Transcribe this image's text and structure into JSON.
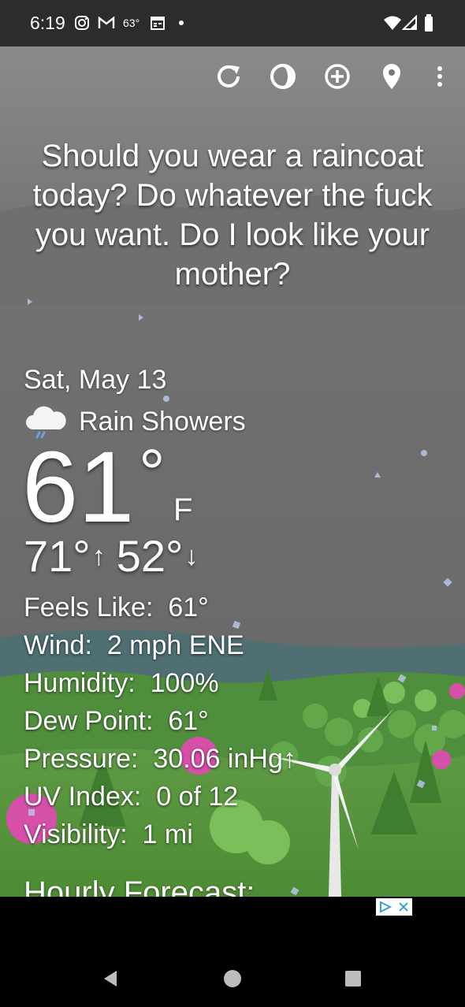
{
  "status_bar": {
    "time": "6:19",
    "temp": "63°",
    "icons": [
      "instagram-icon",
      "gmail-icon",
      "calendar-icon",
      "dot-icon",
      "wifi-icon",
      "signal-icon",
      "battery-icon"
    ]
  },
  "toolbar": {
    "icons": [
      "refresh-icon",
      "theme-icon",
      "add-location-icon",
      "location-pin-icon",
      "more-vert-icon"
    ]
  },
  "quote": "Should you wear a raincoat today? Do whatever the fuck you want. Do I look like your mother?",
  "weather": {
    "date": "Sat, May 13",
    "condition": "Rain Showers",
    "condition_icon": "rain-cloud-icon",
    "temperature": "61",
    "degree_symbol": "°",
    "unit": "F",
    "high": "71°",
    "high_arrow": "↑",
    "low": "52°",
    "low_arrow": "↓"
  },
  "details": [
    {
      "label": "Feels Like:",
      "value": "61°"
    },
    {
      "label": "Wind:",
      "value": "2 mph ENE"
    },
    {
      "label": "Humidity:",
      "value": "100%"
    },
    {
      "label": "Dew Point:",
      "value": "61°"
    },
    {
      "label": "Pressure:",
      "value": "30.06 inHg↑"
    },
    {
      "label": "UV Index:",
      "value": "0 of 12"
    },
    {
      "label": "Visibility:",
      "value": "1 mi"
    }
  ],
  "hourly_title": "Hourly Forecast:",
  "colors": {
    "status_bar": "#2c2c2c",
    "sky": "#6b6b6b",
    "grass": "#5d9a3e",
    "nav_bar": "#000000"
  }
}
